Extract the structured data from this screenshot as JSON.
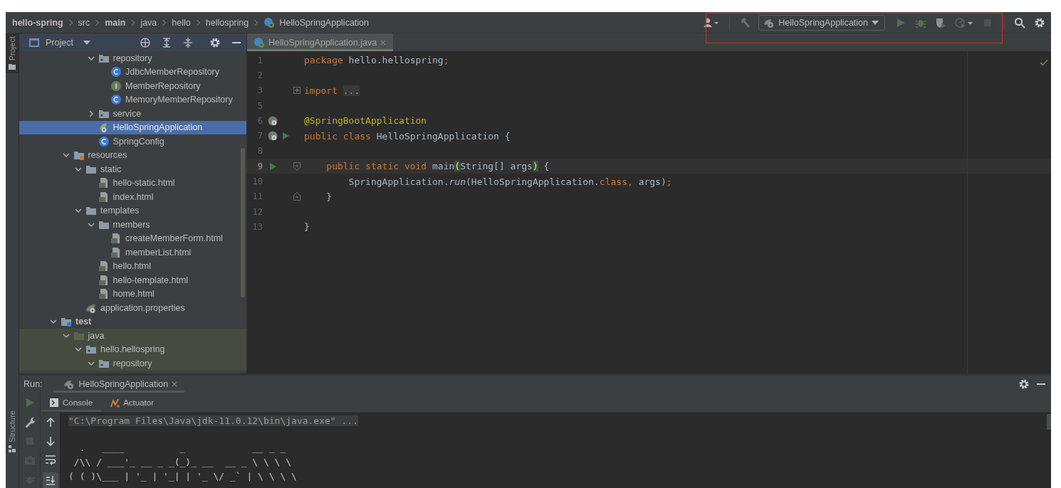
{
  "breadcrumbs": [
    {
      "label": "hello-spring",
      "bold": true
    },
    {
      "label": "src",
      "bold": false
    },
    {
      "label": "main",
      "bold": true
    },
    {
      "label": "java",
      "bold": false
    },
    {
      "label": "hello",
      "bold": false
    },
    {
      "label": "hellospring",
      "bold": false
    },
    {
      "label": "HelloSpringApplication",
      "bold": false,
      "kind": "spring-class"
    }
  ],
  "toolbar": {
    "run_config": "HelloSpringApplication"
  },
  "tool_strip": {
    "top": "Project",
    "bottom": "Structure"
  },
  "project_panel": {
    "title": "Project",
    "tree": [
      {
        "children": [
          {
            "children": [
              {
                "children": [
                  {
                    "label": "repository",
                    "kind": "package",
                    "expanded": true,
                    "selected": false,
                    "children": [
                      {
                        "label": "JdbcMemberRepository",
                        "kind": "class",
                        "selected": false
                      },
                      {
                        "label": "MemberRepository",
                        "kind": "interface",
                        "selected": false
                      },
                      {
                        "label": "MemoryMemberRepository",
                        "kind": "class",
                        "selected": false
                      }
                    ]
                  },
                  {
                    "label": "service",
                    "kind": "package",
                    "expanded": false,
                    "selected": false
                  },
                  {
                    "label": "HelloSpringApplication",
                    "kind": "spring-class",
                    "selected": true
                  },
                  {
                    "label": "SpringConfig",
                    "kind": "class",
                    "selected": false
                  }
                ]
              }
            ]
          },
          {
            "label": "resources",
            "kind": "resources-folder",
            "expanded": true,
            "selected": false,
            "children": [
              {
                "label": "static",
                "kind": "folder",
                "expanded": true,
                "selected": false,
                "children": [
                  {
                    "label": "hello-static.html",
                    "kind": "html",
                    "selected": false
                  },
                  {
                    "label": "index.html",
                    "kind": "html",
                    "selected": false
                  }
                ]
              },
              {
                "label": "templates",
                "kind": "folder",
                "expanded": true,
                "selected": false,
                "children": [
                  {
                    "label": "members",
                    "kind": "folder",
                    "expanded": true,
                    "selected": false,
                    "children": [
                      {
                        "label": "createMemberForm.html",
                        "kind": "html",
                        "selected": false
                      },
                      {
                        "label": "memberList.html",
                        "kind": "html",
                        "selected": false
                      }
                    ]
                  },
                  {
                    "label": "hello.html",
                    "kind": "html",
                    "selected": false
                  },
                  {
                    "label": "hello-template.html",
                    "kind": "html",
                    "selected": false
                  },
                  {
                    "label": "home.html",
                    "kind": "html",
                    "selected": false
                  }
                ]
              },
              {
                "label": "application.properties",
                "kind": "properties",
                "selected": false
              }
            ]
          }
        ]
      },
      {
        "label": "test",
        "kind": "test-folder",
        "expanded": true,
        "selected": false,
        "children": [
          {
            "label": "java",
            "kind": "test-root",
            "expanded": true,
            "selected": false,
            "children": [
              {
                "label": "hello.hellospring",
                "kind": "package",
                "expanded": true,
                "selected": false,
                "children": [
                  {
                    "label": "repository",
                    "kind": "package",
                    "expanded": true,
                    "selected": false
                  }
                ]
              }
            ]
          }
        ]
      }
    ]
  },
  "editor": {
    "tabs": [
      {
        "label": "HelloSpringApplication.java",
        "selected": true
      }
    ],
    "lines": [
      {
        "number": "1",
        "current": false,
        "tokens": [
          {
            "kind": "keyword",
            "text": "package"
          },
          {
            "kind": "plain",
            "text": " hello.hellospring"
          },
          {
            "kind": "keyword",
            "text": ";"
          }
        ]
      },
      {
        "number": "2",
        "current": false
      },
      {
        "number": "3",
        "current": false,
        "fold": {
          "kind": "collapsed"
        },
        "tokens": [
          {
            "kind": "keyword",
            "text": "import"
          },
          {
            "kind": "folded",
            "text": "..."
          }
        ]
      },
      {
        "number": "5",
        "current": false
      },
      {
        "number": "6",
        "current": false,
        "markers": [
          {
            "kind": "bean"
          }
        ],
        "tokens": [
          {
            "kind": "annotation",
            "text": "@SpringBootApplication"
          }
        ]
      },
      {
        "number": "7",
        "current": false,
        "markers": [
          {
            "kind": "bean"
          },
          {
            "kind": "run"
          }
        ],
        "tokens": [
          {
            "kind": "keyword",
            "text": "public class"
          },
          {
            "kind": "plain",
            "text": " HelloSpringApplication {"
          }
        ]
      },
      {
        "number": "8",
        "current": false
      },
      {
        "number": "9",
        "current": true,
        "markers": [
          {
            "kind": "run"
          }
        ],
        "fold": {
          "kind": "start"
        },
        "tokens": [
          {
            "kind": "keyword",
            "text": "    public static void"
          },
          {
            "kind": "plain",
            "text": " main"
          },
          {
            "kind": "brace",
            "text": "("
          },
          {
            "kind": "plain",
            "text": "String[] args"
          },
          {
            "kind": "brace",
            "text": ")"
          },
          {
            "kind": "plain",
            "text": " {"
          }
        ]
      },
      {
        "number": "10",
        "current": false,
        "tokens": [
          {
            "kind": "plain",
            "text": "        SpringApplication."
          },
          {
            "kind": "call",
            "text": "run"
          },
          {
            "kind": "plain",
            "text": "(HelloSpringApplication."
          },
          {
            "kind": "keyword",
            "text": "class, "
          },
          {
            "kind": "plain",
            "text": "args)"
          },
          {
            "kind": "keyword",
            "text": ";"
          }
        ]
      },
      {
        "number": "11",
        "current": false,
        "fold": {
          "kind": "end"
        },
        "tokens": [
          {
            "kind": "plain",
            "text": "    }"
          }
        ]
      },
      {
        "number": "12",
        "current": false
      },
      {
        "number": "13",
        "current": false,
        "tokens": [
          {
            "kind": "plain",
            "text": "}"
          }
        ]
      }
    ]
  },
  "run_panel": {
    "label": "Run:",
    "tabs": [
      {
        "label": "HelloSpringApplication",
        "selected": true
      }
    ],
    "subtabs": [
      {
        "label": "Console",
        "kind": "console",
        "selected": true
      },
      {
        "label": "Actuator",
        "kind": "actuator",
        "selected": false
      }
    ],
    "console": [
      {
        "kind": "command",
        "text": "\"C:\\Program Files\\Java\\jdk-11.0.12\\bin\\java.exe\" ..."
      },
      {
        "kind": "banner",
        "text": "  .   ____          _            __ _ _"
      },
      {
        "kind": "banner",
        "text": " /\\\\ / ___'_ __ _ _(_)_ __  __ _ \\ \\ \\ \\"
      },
      {
        "kind": "banner",
        "text": "( ( )\\___ | '_ | '_| | '_ \\/ _` | \\ \\ \\ \\"
      }
    ]
  }
}
